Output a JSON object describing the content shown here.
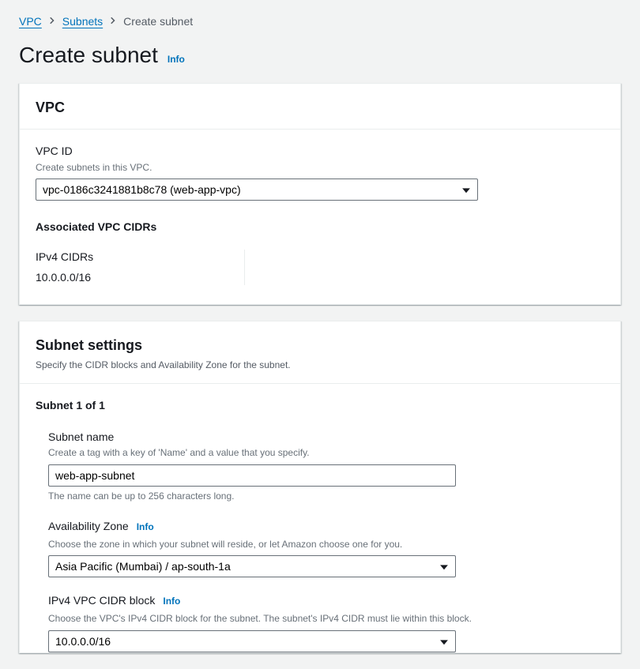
{
  "breadcrumb": {
    "vpc": "VPC",
    "subnets": "Subnets",
    "current": "Create subnet"
  },
  "header": {
    "title": "Create subnet",
    "info": "Info"
  },
  "vpc_panel": {
    "title": "VPC",
    "vpc_id_label": "VPC ID",
    "vpc_id_desc": "Create subnets in this VPC.",
    "vpc_id_value": "vpc-0186c3241881b8c78 (web-app-vpc)",
    "assoc_cidrs_title": "Associated VPC CIDRs",
    "ipv4_label": "IPv4 CIDRs",
    "ipv4_value": "10.0.0.0/16"
  },
  "subnet_panel": {
    "title": "Subnet settings",
    "subtitle": "Specify the CIDR blocks and Availability Zone for the subnet.",
    "subnet_heading": "Subnet 1 of 1",
    "name_label": "Subnet name",
    "name_desc": "Create a tag with a key of 'Name' and a value that you specify.",
    "name_value": "web-app-subnet",
    "name_helper": "The name can be up to 256 characters long.",
    "az_label": "Availability Zone",
    "az_info": "Info",
    "az_desc": "Choose the zone in which your subnet will reside, or let Amazon choose one for you.",
    "az_value": "Asia Pacific (Mumbai) / ap-south-1a",
    "cidr_label": "IPv4 VPC CIDR block",
    "cidr_info": "Info",
    "cidr_desc": "Choose the VPC's IPv4 CIDR block for the subnet. The subnet's IPv4 CIDR must lie within this block.",
    "cidr_value": "10.0.0.0/16"
  }
}
